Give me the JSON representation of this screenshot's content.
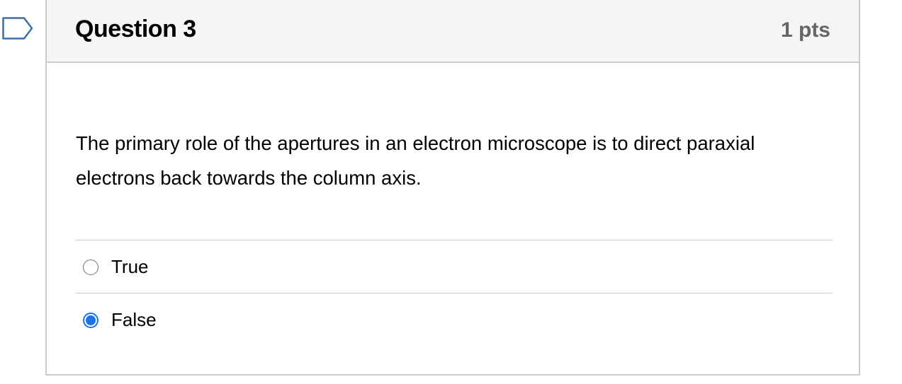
{
  "question": {
    "title": "Question 3",
    "points": "1 pts",
    "text": "The primary role of the apertures in an electron microscope is to direct paraxial electrons back towards the column axis.",
    "answers": [
      {
        "label": "True",
        "selected": false
      },
      {
        "label": "False",
        "selected": true
      }
    ]
  },
  "icons": {
    "flag": "flag-bookmark-icon",
    "radio_unselected": "radio-empty-icon",
    "radio_selected": "radio-filled-icon"
  },
  "colors": {
    "accent": "#1a73e8",
    "border": "#c7cdd1",
    "header_bg": "#f5f5f5",
    "points_text": "#666666"
  }
}
